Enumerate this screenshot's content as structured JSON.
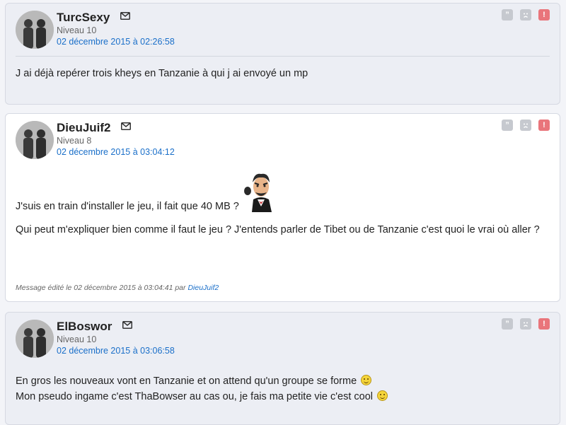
{
  "posts": [
    {
      "author": "TurcSexy",
      "level": "Niveau 10",
      "date": "02 décembre 2015 à 02:26:58",
      "body": [
        "J ai déjà repérer trois kheys en Tanzanie à qui j ai envoyé un mp"
      ]
    },
    {
      "author": "DieuJuif2",
      "level": "Niveau 8",
      "date": "02 décembre 2015 à 03:04:12",
      "body": [
        "J'suis en train d'installer le jeu, il fait que 40 MB ?",
        "Qui peut m'expliquer bien comme il faut le jeu ? J'entends parler de Tibet ou de Tanzanie c'est quoi le vrai où aller ?"
      ],
      "edit_prefix": "Message édité le 02 décembre 2015 à 03:04:41 par",
      "edit_by": "DieuJuif2"
    },
    {
      "author": "ElBoswor",
      "level": "Niveau 10",
      "date": "02 décembre 2015 à 03:06:58",
      "body": [
        "En gros les nouveaux vont en Tanzanie et on attend qu'un groupe se forme",
        "Mon pseudo ingame c'est ThaBowser au cas ou, je fais ma petite vie c'est cool"
      ]
    }
  ],
  "icons": {
    "mail": "envelope-icon",
    "quote": "quote-icon",
    "sad": "sad-face-icon",
    "report": "report-icon",
    "smiley": "smiley-icon",
    "sticker": "angry-man-sticker"
  },
  "colors": {
    "link": "#1a6fc9",
    "report": "#e9757b",
    "action_grey": "#c6c9cf"
  }
}
